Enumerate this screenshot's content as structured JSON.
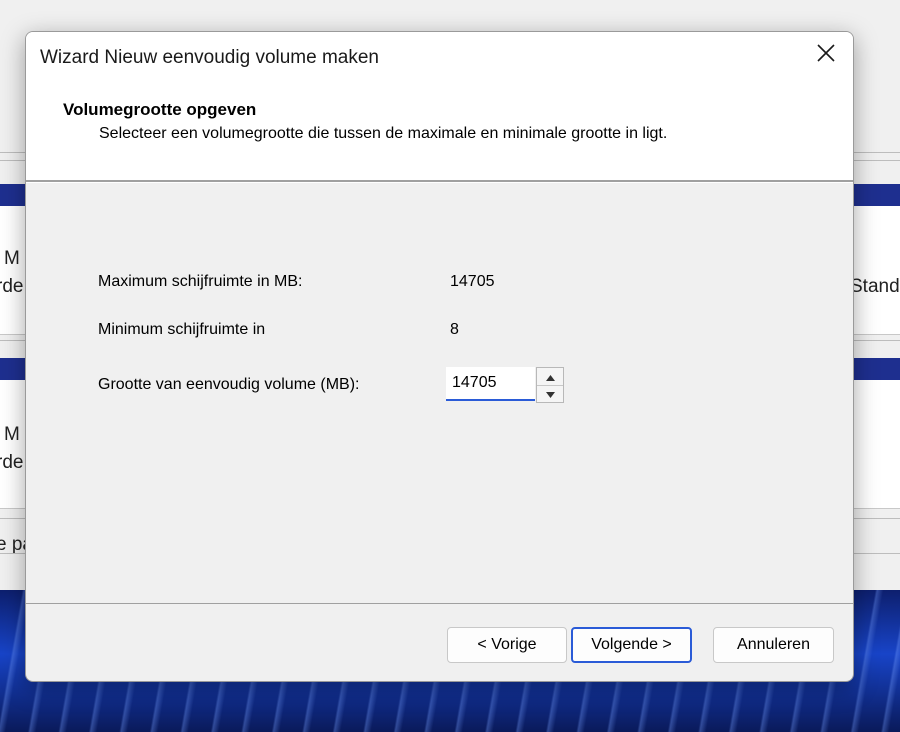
{
  "background": {
    "texts": [
      "M",
      "rde",
      "Standa",
      "M",
      "rde",
      "e pa"
    ]
  },
  "dialog": {
    "title": "Wizard Nieuw eenvoudig volume maken",
    "section_title": "Volumegrootte opgeven",
    "section_description": "Selecteer een volumegrootte die tussen de maximale en minimale grootte in ligt.",
    "fields": {
      "max_label": "Maximum schijfruimte in MB:",
      "max_value": "14705",
      "min_label": "Minimum schijfruimte in",
      "min_value": "8",
      "size_label": "Grootte van eenvoudig volume (MB):",
      "size_value": "14705"
    },
    "buttons": {
      "back": "< Vorige",
      "next": "Volgende >",
      "cancel": "Annuleren"
    }
  },
  "icons": {
    "close": "close-icon",
    "spin_up": "arrow-up-icon",
    "spin_down": "arrow-down-icon"
  },
  "colors": {
    "accent": "#2a5bd7",
    "dialog_bg": "#f0f0f0",
    "header_bg": "#ffffff"
  }
}
